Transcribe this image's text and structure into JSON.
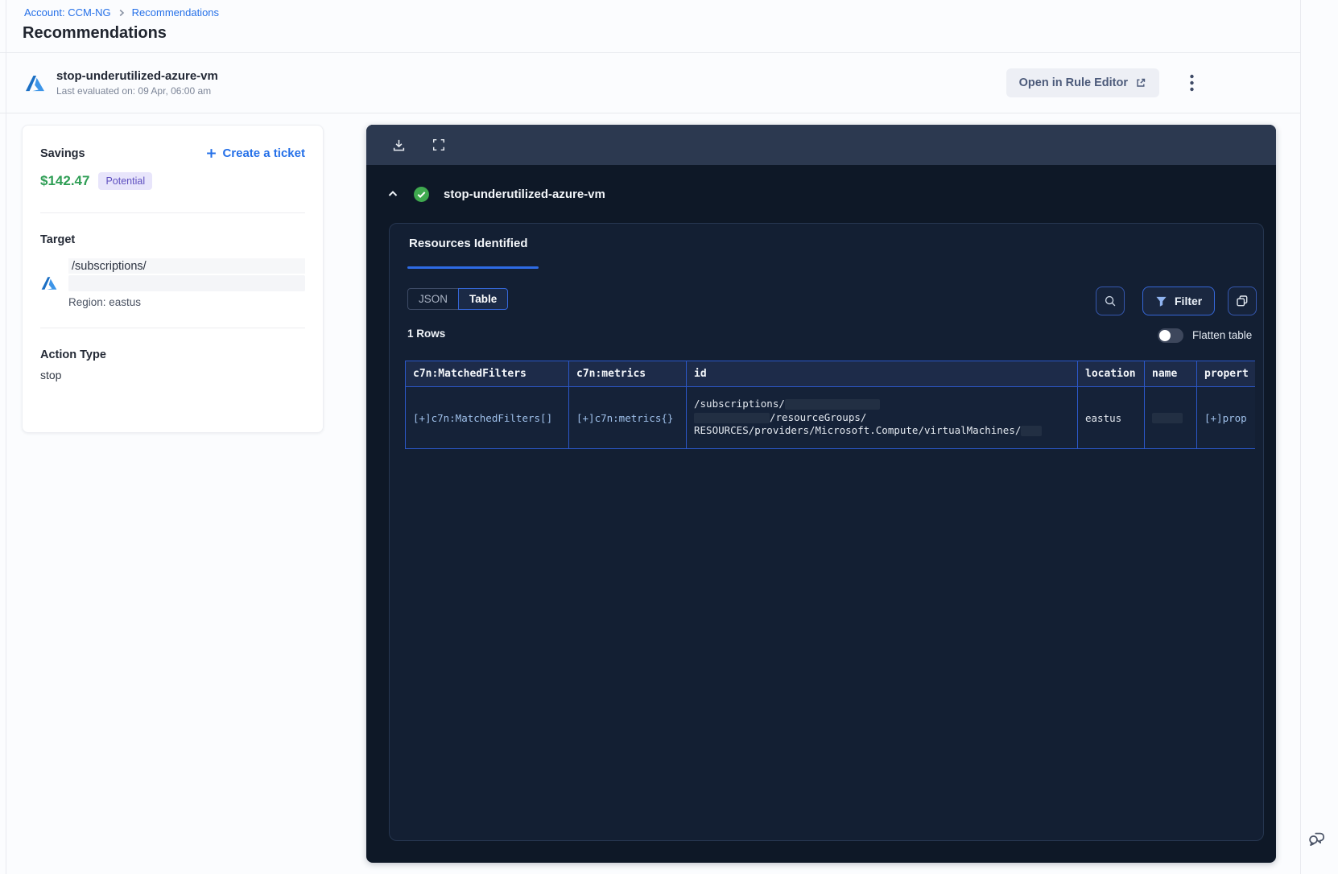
{
  "colors": {
    "accent_blue": "#2570e8",
    "savings_green": "#2f9e55",
    "badge_purple": "#5f50c0",
    "table_border_blue": "#2b57c8",
    "panel_bg": "#0e1827",
    "toolbar_bg": "#2c3950"
  },
  "breadcrumb": {
    "account": "Account: CCM-NG",
    "page": "Recommendations"
  },
  "page_title": "Recommendations",
  "rule_header": {
    "title": "stop-underutilized-azure-vm",
    "last_evaluated": "Last evaluated on: 09 Apr, 06:00 am",
    "open_in_rule_editor": "Open in Rule Editor"
  },
  "savings_card": {
    "savings_label": "Savings",
    "create_ticket": "Create a ticket",
    "amount": "$142.47",
    "badge": "Potential",
    "target_label": "Target",
    "target_path": "/subscriptions/",
    "region": "Region: eastus",
    "action_type_label": "Action Type",
    "action_type_value": "stop"
  },
  "results_panel": {
    "rule_title": "stop-underutilized-azure-vm",
    "tab_label": "Resources Identified",
    "view_json": "JSON",
    "view_table": "Table",
    "selected_view": "Table",
    "filter_label": "Filter",
    "rows_count": "1 Rows",
    "flatten_label": "Flatten table",
    "table": {
      "columns": [
        "c7n:MatchedFilters",
        "c7n:metrics",
        "id",
        "location",
        "name",
        "propert"
      ],
      "row": {
        "matched_filters": "[+]c7n:MatchedFilters[]",
        "metrics": "[+]c7n:metrics{}",
        "id_line1": "/subscriptions/",
        "id_line2": "/resourceGroups/",
        "id_line3": "RESOURCES/providers/Microsoft.Compute/virtualMachines/",
        "location": "eastus",
        "name": "",
        "properties": "[+]prop"
      }
    }
  }
}
